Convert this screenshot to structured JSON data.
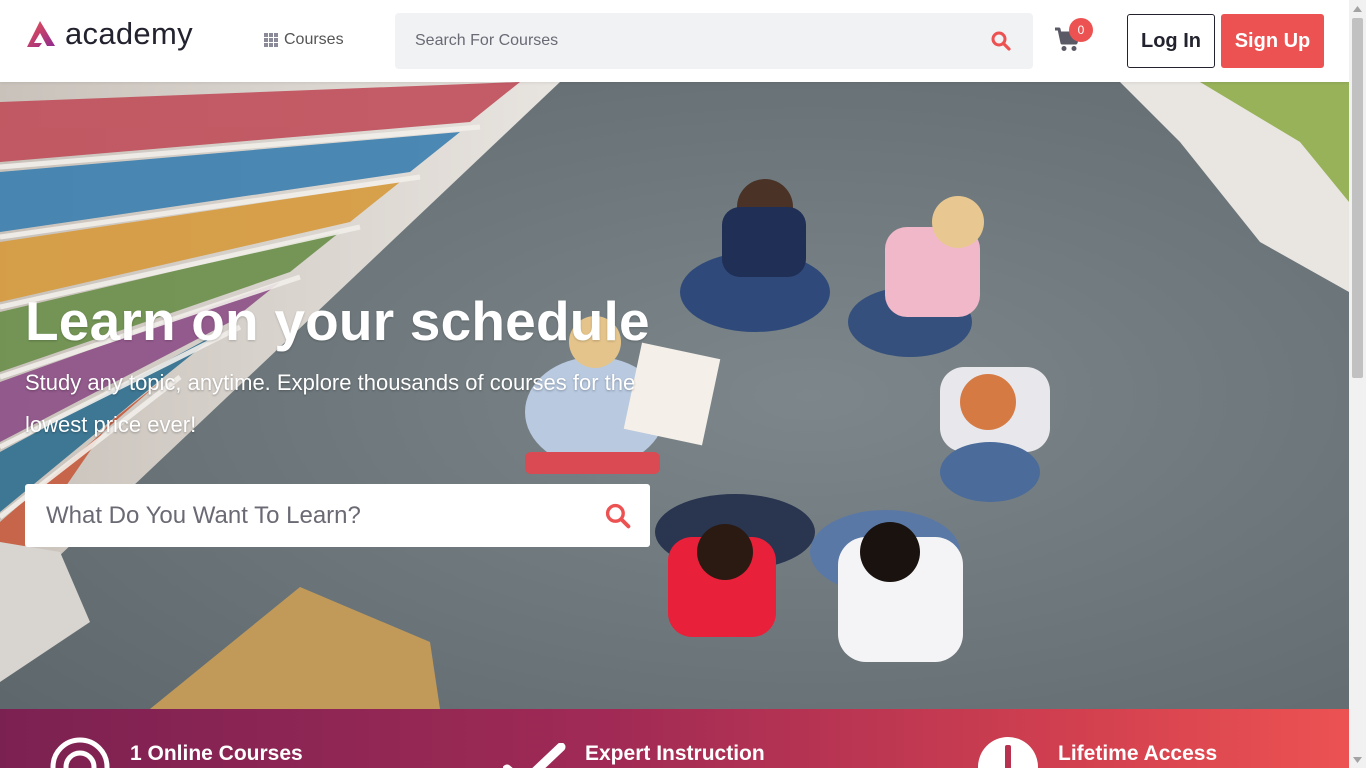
{
  "brand": {
    "name": "academy",
    "accent": "#ec5252",
    "dark": "#23232f"
  },
  "nav": {
    "courses_label": "Courses",
    "search_placeholder": "Search For Courses",
    "cart_count": "0",
    "login_label": "Log In",
    "signup_label": "Sign Up"
  },
  "hero": {
    "title": "Learn on your schedule",
    "subtitle": "Study any topic, anytime. Explore thousands of courses for the lowest price ever!",
    "search_placeholder": "What Do You Want To Learn?"
  },
  "features": [
    {
      "icon": "target-icon",
      "label": "1 Online Courses"
    },
    {
      "icon": "check-icon",
      "label": "Expert Instruction"
    },
    {
      "icon": "clock-icon",
      "label": "Lifetime Access"
    }
  ]
}
